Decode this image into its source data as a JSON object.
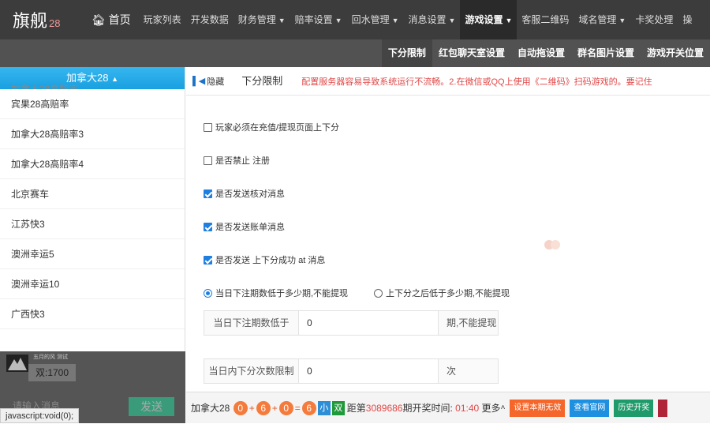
{
  "brand": {
    "name": "旗舰",
    "suffix": "28"
  },
  "nav": {
    "home": "首页",
    "items": [
      {
        "label": "玩家列表",
        "caret": false
      },
      {
        "label": "开发数据",
        "caret": false
      },
      {
        "label": "财务管理",
        "caret": true
      },
      {
        "label": "赔率设置",
        "caret": true
      },
      {
        "label": "回水管理",
        "caret": true
      },
      {
        "label": "消息设置",
        "caret": true
      },
      {
        "label": "游戏设置",
        "caret": true,
        "active": true
      },
      {
        "label": "客服二维码",
        "caret": false
      },
      {
        "label": "域名管理",
        "caret": true
      },
      {
        "label": "卡奖处理",
        "caret": false
      },
      {
        "label": "操",
        "caret": false
      }
    ]
  },
  "subnav": [
    "下分限制",
    "红包聊天室设置",
    "自动拖设置",
    "群名图片设置",
    "游戏开关位置"
  ],
  "sidebar": {
    "header": "加拿大28",
    "header_ghost": "加拿大28高赔率",
    "items": [
      "宾果28高赔率",
      "加拿大28高赔率3",
      "加拿大28高赔率4",
      "北京赛车",
      "江苏快3",
      "澳洲幸运5",
      "澳洲幸运10",
      "广西快3"
    ]
  },
  "chat": {
    "meta": "五月的风 测试",
    "bubble": "双:1700",
    "input_placeholder": "请输入消息",
    "send": "发送"
  },
  "status_url": "javascript:void(0);",
  "tabs": {
    "hide": "隐藏",
    "active": "下分限制",
    "marquee": "配置服务器容易导致系统运行不流畅。2.在微信或QQ上使用《二维码》扫码游戏的。要记住"
  },
  "options": {
    "must_recharge": "玩家必须在充值/提现页面上下分",
    "ban_register": "是否禁止 注册",
    "send_check": "是否发送核对消息",
    "send_bill": "是否发送账单消息",
    "send_at": "是否发送 上下分成功 at 消息",
    "radio_a": "当日下注期数低于多少期,不能提现",
    "radio_b": "上下分之后低于多少期,不能提现"
  },
  "fields": {
    "f1": {
      "label": "当日下注期数低于",
      "value": "0",
      "suffix": "期,不能提现"
    },
    "f2": {
      "label": "当日内下分次数限制",
      "value": "0",
      "suffix": "次"
    }
  },
  "bottom": {
    "game": "加拿大28",
    "balls": [
      "0",
      "6",
      "0",
      "6"
    ],
    "ops": [
      "+",
      "+",
      "="
    ],
    "tag_small": "小",
    "tag_double": "双",
    "dist_prefix": "距第",
    "period": "3089686",
    "period_suffix": "期开奖时间:",
    "countdown": "01:40",
    "more": "更多",
    "btn_invalid": "设置本期无效",
    "btn_site": "查看官网",
    "btn_history": "历史开奖"
  },
  "colors": {
    "topbar": "#3c3c3c",
    "subbar": "#525252",
    "sidebar_head": "#1aa0e0",
    "ball": "#f47b3c",
    "tag_small": "#2d8ed8",
    "tag_double": "#1f9a3a",
    "btn_invalid": "#f5662a",
    "btn_site": "#1e90e0",
    "btn_history": "#1f9a6a",
    "marquee": "#e04848"
  }
}
